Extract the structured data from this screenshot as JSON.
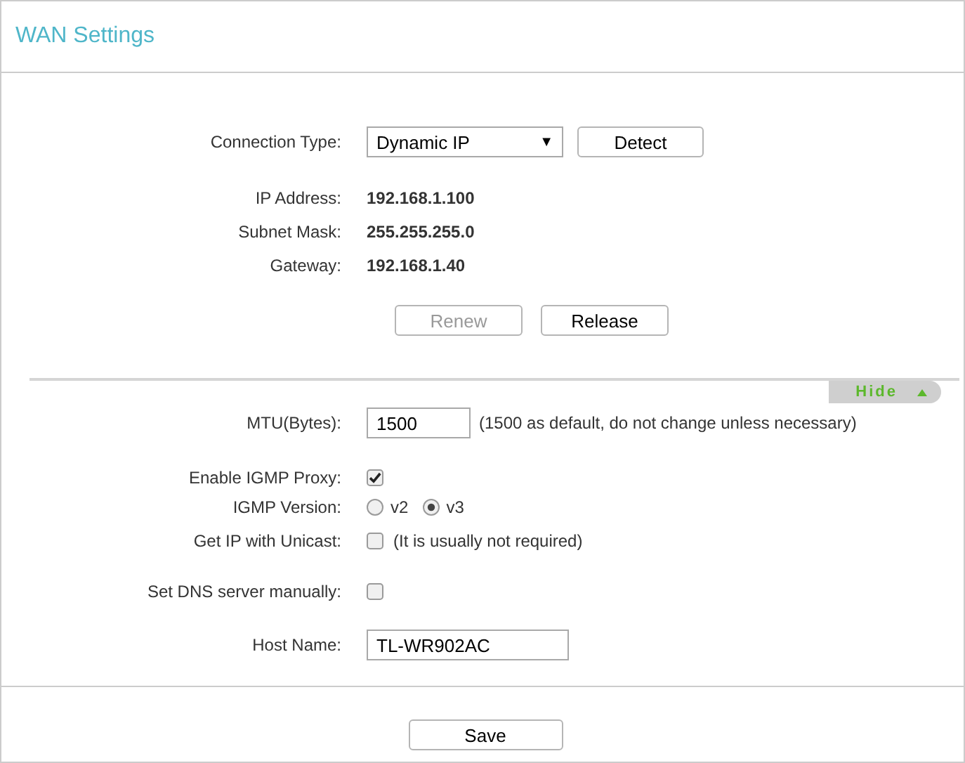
{
  "title": "WAN Settings",
  "connection": {
    "label": "Connection Type:",
    "value": "Dynamic IP",
    "arrow": "▼",
    "detect": "Detect"
  },
  "info": [
    {
      "label": "IP Address:",
      "value": "192.168.1.100"
    },
    {
      "label": "Subnet Mask:",
      "value": "255.255.255.0"
    },
    {
      "label": "Gateway:",
      "value": "192.168.1.40"
    }
  ],
  "actions": [
    {
      "label": "Renew",
      "disabled": true
    },
    {
      "label": "Release",
      "disabled": false
    }
  ],
  "toggle": {
    "label": "Hide",
    "expanded": true
  },
  "mtu": {
    "label": "MTU(Bytes):",
    "value": "1500",
    "note": "(1500 as default, do not change unless necessary)"
  },
  "igmp_proxy": {
    "label": "Enable IGMP Proxy:",
    "checked": true
  },
  "igmp_version": {
    "label": "IGMP Version:",
    "options": [
      {
        "label": "v2",
        "selected": false
      },
      {
        "label": "v3",
        "selected": true
      }
    ]
  },
  "unicast": {
    "label": "Get IP with Unicast:",
    "checked": false,
    "note": "(It is usually not required)"
  },
  "dns": {
    "label": "Set DNS server manually:",
    "checked": false
  },
  "host": {
    "label": "Host Name:",
    "value": "TL-WR902AC"
  },
  "save": "Save"
}
